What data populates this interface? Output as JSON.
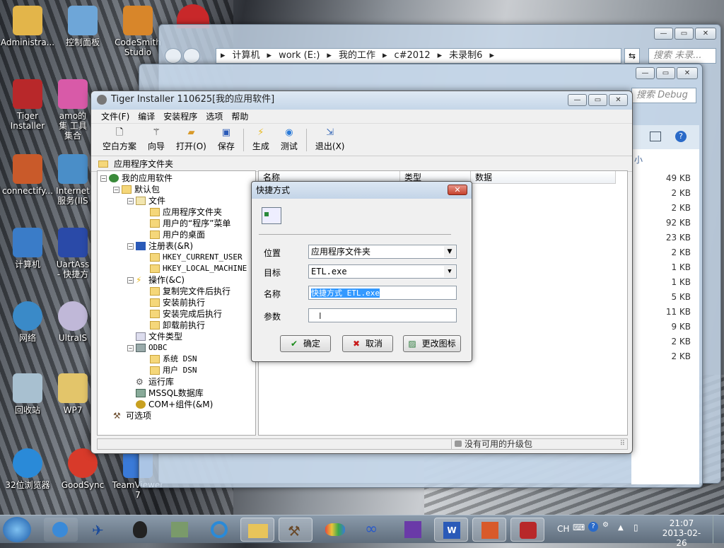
{
  "desktop": {
    "icons": [
      {
        "label": "Administra..."
      },
      {
        "label": "控制面板"
      },
      {
        "label": "CodeSmith Studio"
      },
      {
        "label": "Tiger Installer"
      },
      {
        "label": "amo的集 工具集合"
      },
      {
        "label": "connectify..."
      },
      {
        "label": "Internet 服务(IIS"
      },
      {
        "label": "计算机"
      },
      {
        "label": "UartAss - 快捷方"
      },
      {
        "label": "网络"
      },
      {
        "label": "UltraIS"
      },
      {
        "label": "回收站"
      },
      {
        "label": "WP7"
      },
      {
        "label": "32位浏览器"
      },
      {
        "label": "GoodSync"
      },
      {
        "label": "TeamViewer 7"
      }
    ]
  },
  "explorer": {
    "path": [
      "计算机",
      "work (E:)",
      "我的工作",
      "c#2012",
      "未录制6"
    ],
    "search_placeholder": "搜索 未录...",
    "search2_placeholder": "搜索 Debug",
    "sizes_header": "小",
    "sizes": [
      "49 KB",
      "2 KB",
      "2 KB",
      "92 KB",
      "23 KB",
      "2 KB",
      "1 KB",
      "1 KB",
      "5 KB",
      "11 KB",
      "9 KB",
      "2 KB",
      "2 KB"
    ]
  },
  "app": {
    "title": "Tiger Installer  110625[我的应用软件]",
    "menu": [
      "文件(F)",
      "编译",
      "安装程序",
      "选项",
      "帮助"
    ],
    "toolbar": [
      "空白方案",
      "向导",
      "打开(O)",
      "保存",
      "生成",
      "测试",
      "退出(X)"
    ],
    "pathbar": "应用程序文件夹",
    "tree": {
      "root": "我的应用软件",
      "default_pkg": "默认包",
      "files": "文件",
      "app_folder": "应用程序文件夹",
      "user_programs": "用户的“程序”菜单",
      "user_desktop": "用户的桌面",
      "registry": "注册表(&R)",
      "hkcu": "HKEY_CURRENT_USER",
      "hklm": "HKEY_LOCAL_MACHINE",
      "actions": "操作(&C)",
      "act1": "复制完文件后执行",
      "act2": "安装前执行",
      "act3": "安装完成后执行",
      "act4": "卸载前执行",
      "filetypes": "文件类型",
      "odbc": "ODBC",
      "sys_dsn": "系统 DSN",
      "user_dsn": "用户 DSN",
      "runtime": "运行库",
      "mssql": "MSSQL数据库",
      "com": "COM+组件(&M)",
      "optional": "可选项"
    },
    "list_headers": [
      "名称",
      "类型",
      "数据"
    ],
    "status": "没有可用的升级包"
  },
  "dialog": {
    "title": "快捷方式",
    "close": "✕",
    "location_label": "位置",
    "location_value": "应用程序文件夹",
    "target_label": "目标",
    "target_value": "ETL.exe",
    "name_label": "名称",
    "name_value": "快捷方式 ETL.exe",
    "params_label": "参数",
    "params_value": "",
    "ok": "确定",
    "cancel": "取消",
    "change_icon": "更改图标"
  },
  "taskbar": {
    "lang": "CH",
    "time": "21:07",
    "date": "2013-02-26"
  }
}
